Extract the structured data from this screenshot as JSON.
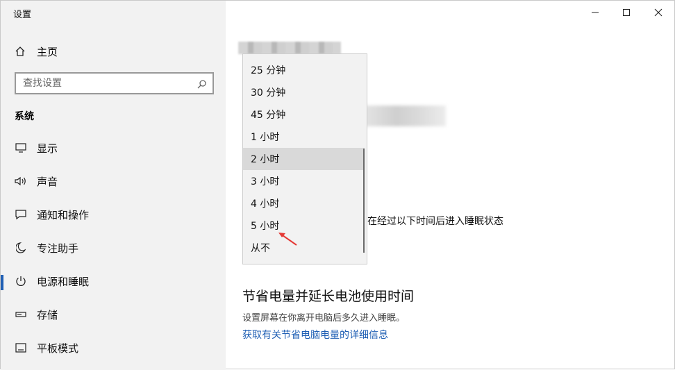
{
  "window": {
    "title": "设置",
    "controls": [
      {
        "name": "minimize",
        "icon": "minimize-icon"
      },
      {
        "name": "maximize",
        "icon": "maximize-icon"
      },
      {
        "name": "close",
        "icon": "close-icon"
      }
    ]
  },
  "sidebar": {
    "home_label": "主页",
    "search_placeholder": "查找设置",
    "section_title": "系统",
    "items": [
      {
        "label": "显示",
        "icon": "monitor-icon"
      },
      {
        "label": "声音",
        "icon": "speaker-icon"
      },
      {
        "label": "通知和操作",
        "icon": "notification-icon"
      },
      {
        "label": "专注助手",
        "icon": "moon-icon"
      },
      {
        "label": "电源和睡眠",
        "icon": "power-icon",
        "active": true
      },
      {
        "label": "存储",
        "icon": "storage-icon"
      },
      {
        "label": "平板模式",
        "icon": "tablet-icon"
      }
    ]
  },
  "dropdown": {
    "options": [
      "25 分钟",
      "30 分钟",
      "45 分钟",
      "1 小时",
      "2 小时",
      "3 小时",
      "4 小时",
      "5 小时",
      "从不"
    ],
    "selected": "2 小时"
  },
  "main": {
    "sleep_label": "在经过以下时间后进入睡眠状态",
    "section_title": "节省电量并延长电池使用时间",
    "section_desc": "设置屏幕在你离开电脑后多久进入睡眠。",
    "link_text": "获取有关节省电脑电量的详细信息"
  },
  "colors": {
    "accent": "#1f5fb4",
    "sidebar_bg": "#f2f2f2",
    "dropdown_selected": "#d9d9d9",
    "annotation_arrow": "#e53935"
  }
}
